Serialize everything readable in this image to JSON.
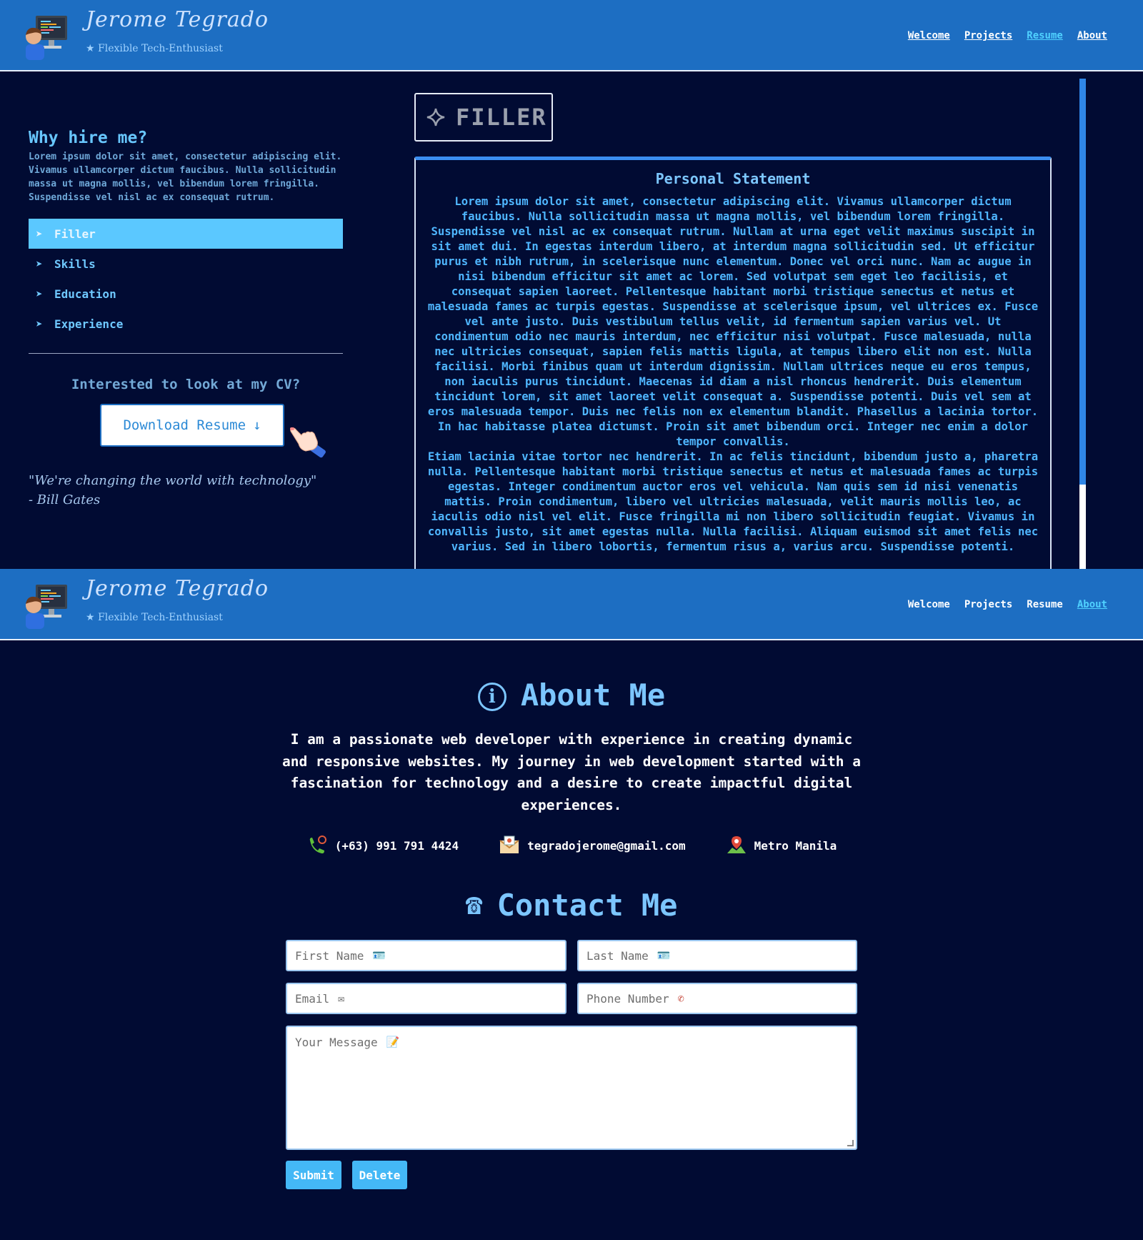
{
  "header": {
    "name": "Jerome Tegrado",
    "tagline": "★ Flexible Tech-Enthusiast",
    "nav": [
      "Welcome",
      "Projects",
      "Resume",
      "About"
    ]
  },
  "resume": {
    "why_title": "Why hire me?",
    "why_text": "Lorem ipsum dolor sit amet, consectetur adipiscing elit. Vivamus ullamcorper dictum faucibus. Nulla sollicitudin massa ut magna mollis, vel bibendum lorem fringilla. Suspendisse vel nisl ac ex consequat rutrum.",
    "menu": [
      "Filler",
      "Skills",
      "Education",
      "Experience"
    ],
    "cv_question": "Interested to look at my CV?",
    "download_label": "Download Resume",
    "quote_line1": "\"We're changing the world with technology\"",
    "quote_line2": "- Bill Gates",
    "filler_label": "FILLER",
    "statement_title": "Personal Statement",
    "statement_text": "Lorem ipsum dolor sit amet, consectetur adipiscing elit. Vivamus ullamcorper dictum faucibus. Nulla sollicitudin massa ut magna mollis, vel bibendum lorem fringilla. Suspendisse vel nisl ac ex consequat rutrum. Nullam at urna eget velit maximus suscipit in sit amet dui. In egestas interdum libero, at interdum magna sollicitudin sed. Ut efficitur purus et nibh rutrum, in scelerisque nunc elementum. Donec vel orci nunc. Nam ac augue in nisi bibendum efficitur sit amet ac lorem. Sed volutpat sem eget leo facilisis, et consequat sapien laoreet. Pellentesque habitant morbi tristique senectus et netus et malesuada fames ac turpis egestas. Suspendisse at scelerisque ipsum, vel ultrices ex. Fusce vel ante justo. Duis vestibulum tellus velit, id fermentum sapien varius vel. Ut condimentum odio nec mauris interdum, nec efficitur nisi volutpat. Fusce malesuada, nulla nec ultricies consequat, sapien felis mattis ligula, at tempus libero elit non est. Nulla facilisi. Morbi finibus quam ut interdum dignissim. Nullam ultrices neque eu eros tempus, non iaculis purus tincidunt. Maecenas id diam a nisl rhoncus hendrerit. Duis elementum tincidunt lorem, sit amet laoreet velit consequat a. Suspendisse potenti. Duis vel sem at eros malesuada tempor. Duis nec felis non ex elementum blandit. Phasellus a lacinia tortor. In hac habitasse platea dictumst. Proin sit amet bibendum orci. Integer nec enim a dolor tempor convallis.",
    "statement_text_2": "Etiam lacinia vitae tortor nec hendrerit. In ac felis tincidunt, bibendum justo a, pharetra nulla. Pellentesque habitant morbi tristique senectus et netus et malesuada fames ac turpis egestas. Integer condimentum auctor eros vel vehicula. Nam quis sem id nisi venenatis mattis. Proin condimentum, libero vel ultricies malesuada, velit mauris mollis leo, ac iaculis odio nisl vel elit. Fusce fringilla mi non libero sollicitudin feugiat. Vivamus in convallis justo, sit amet egestas nulla. Nulla facilisi. Aliquam euismod sit amet felis nec varius. Sed in libero lobortis, fermentum risus a, varius arcu. Suspendisse potenti."
  },
  "about": {
    "title": "About Me",
    "text": "I am a passionate web developer with experience in creating dynamic and responsive websites. My journey in web development started with a fascination for technology and a desire to create impactful digital experiences.",
    "phone": "(+63) 991 791 4424",
    "email": "tegradojerome@gmail.com",
    "location": "Metro Manila"
  },
  "contact": {
    "title": "Contact Me",
    "first_name": "First Name",
    "last_name": "Last Name",
    "email": "Email",
    "phone": "Phone Number",
    "message": "Your Message",
    "submit": "Submit",
    "delete": "Delete"
  },
  "colors": {
    "background": "#010b33",
    "header": "#1d6ec2",
    "accent": "#5bc8ff",
    "active_nav": "#4fd1ff"
  }
}
